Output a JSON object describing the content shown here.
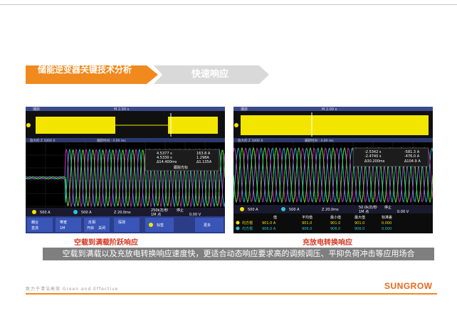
{
  "header": {
    "section_title": "储能逆变器关键技术分析",
    "subsection_title": "快速响应"
  },
  "scope_left": {
    "top_menu": "捕获",
    "timebase_top": "M 2.00 s",
    "zoom_label": "放大的 Z 1000 X",
    "zoom_time": "捕获时间 : 4.00 ms",
    "cursor": {
      "t1": "4.5377 s",
      "v1": "163.8 A",
      "t2": "4.5330 s",
      "v2": "1.298A",
      "dt": "Δ14.400ms",
      "dv": "Δ1.135A",
      "note": "跟踪光标"
    },
    "ch1": "500 A",
    "ch2": "500 A",
    "timebase": "Z 20.0ms",
    "rate": "250k次/秒",
    "points": "1M 点",
    "trigger_level": "0.00 V",
    "stop": "停止",
    "buttons": [
      "耦合",
      "带宽",
      "反相",
      "探测",
      "标签",
      "更多"
    ],
    "button_sub": [
      "直流",
      "1M",
      "开启",
      "关闭"
    ],
    "label_button": "标签",
    "more_button": "更多"
  },
  "scope_right": {
    "top_menu": "捕获",
    "timebase_top": "M 2.00 s",
    "zoom_label": "放大的 Z 1000 X",
    "zoom_time": "捕获时间 : 4.00 ms",
    "cursor": {
      "t1": "-2.5342 s",
      "v1": "-581.3 A",
      "t2": "-2.4740 s",
      "v2": "-476.0 A",
      "dt": "Δ30.200ms",
      "dv": "Δ104.9 A"
    },
    "ch1": "500 A",
    "ch2": "500 A",
    "timebase": "Z 20.0ms",
    "rate": "50.0k次/秒",
    "points": "1M 点",
    "trigger_level": "0.00 V",
    "stop": "停止",
    "table_headers": [
      "值",
      "平均值",
      "最小值",
      "最大值",
      "标准差"
    ],
    "table_rows": [
      {
        "label": "均方根",
        "values": [
          "901.0 A",
          "901.0",
          "901.0",
          "901.0",
          "0.000"
        ]
      },
      {
        "label": "均方根",
        "values": [
          "906.0 A",
          "906.0",
          "906.0",
          "906.0",
          "0.000"
        ]
      }
    ]
  },
  "captions": {
    "left": "空载到满载阶跃响应",
    "right": "充放电转换响应"
  },
  "description": "空载到满载以及充放电转换响应速度快，更适合动态响应要求高的调频调压、平抑负荷冲击等应用场合",
  "footer": {
    "slogan": "致力于清洁高效   Green and Effective",
    "logo": "SUNGROW"
  },
  "colors": {
    "accent": "#f08a1e",
    "caption": "#d6361f",
    "scope_yellow": "#f2e600",
    "scope_cyan": "#29c7d6",
    "scope_magenta": "#d13ad1",
    "scope_green": "#48c848"
  }
}
